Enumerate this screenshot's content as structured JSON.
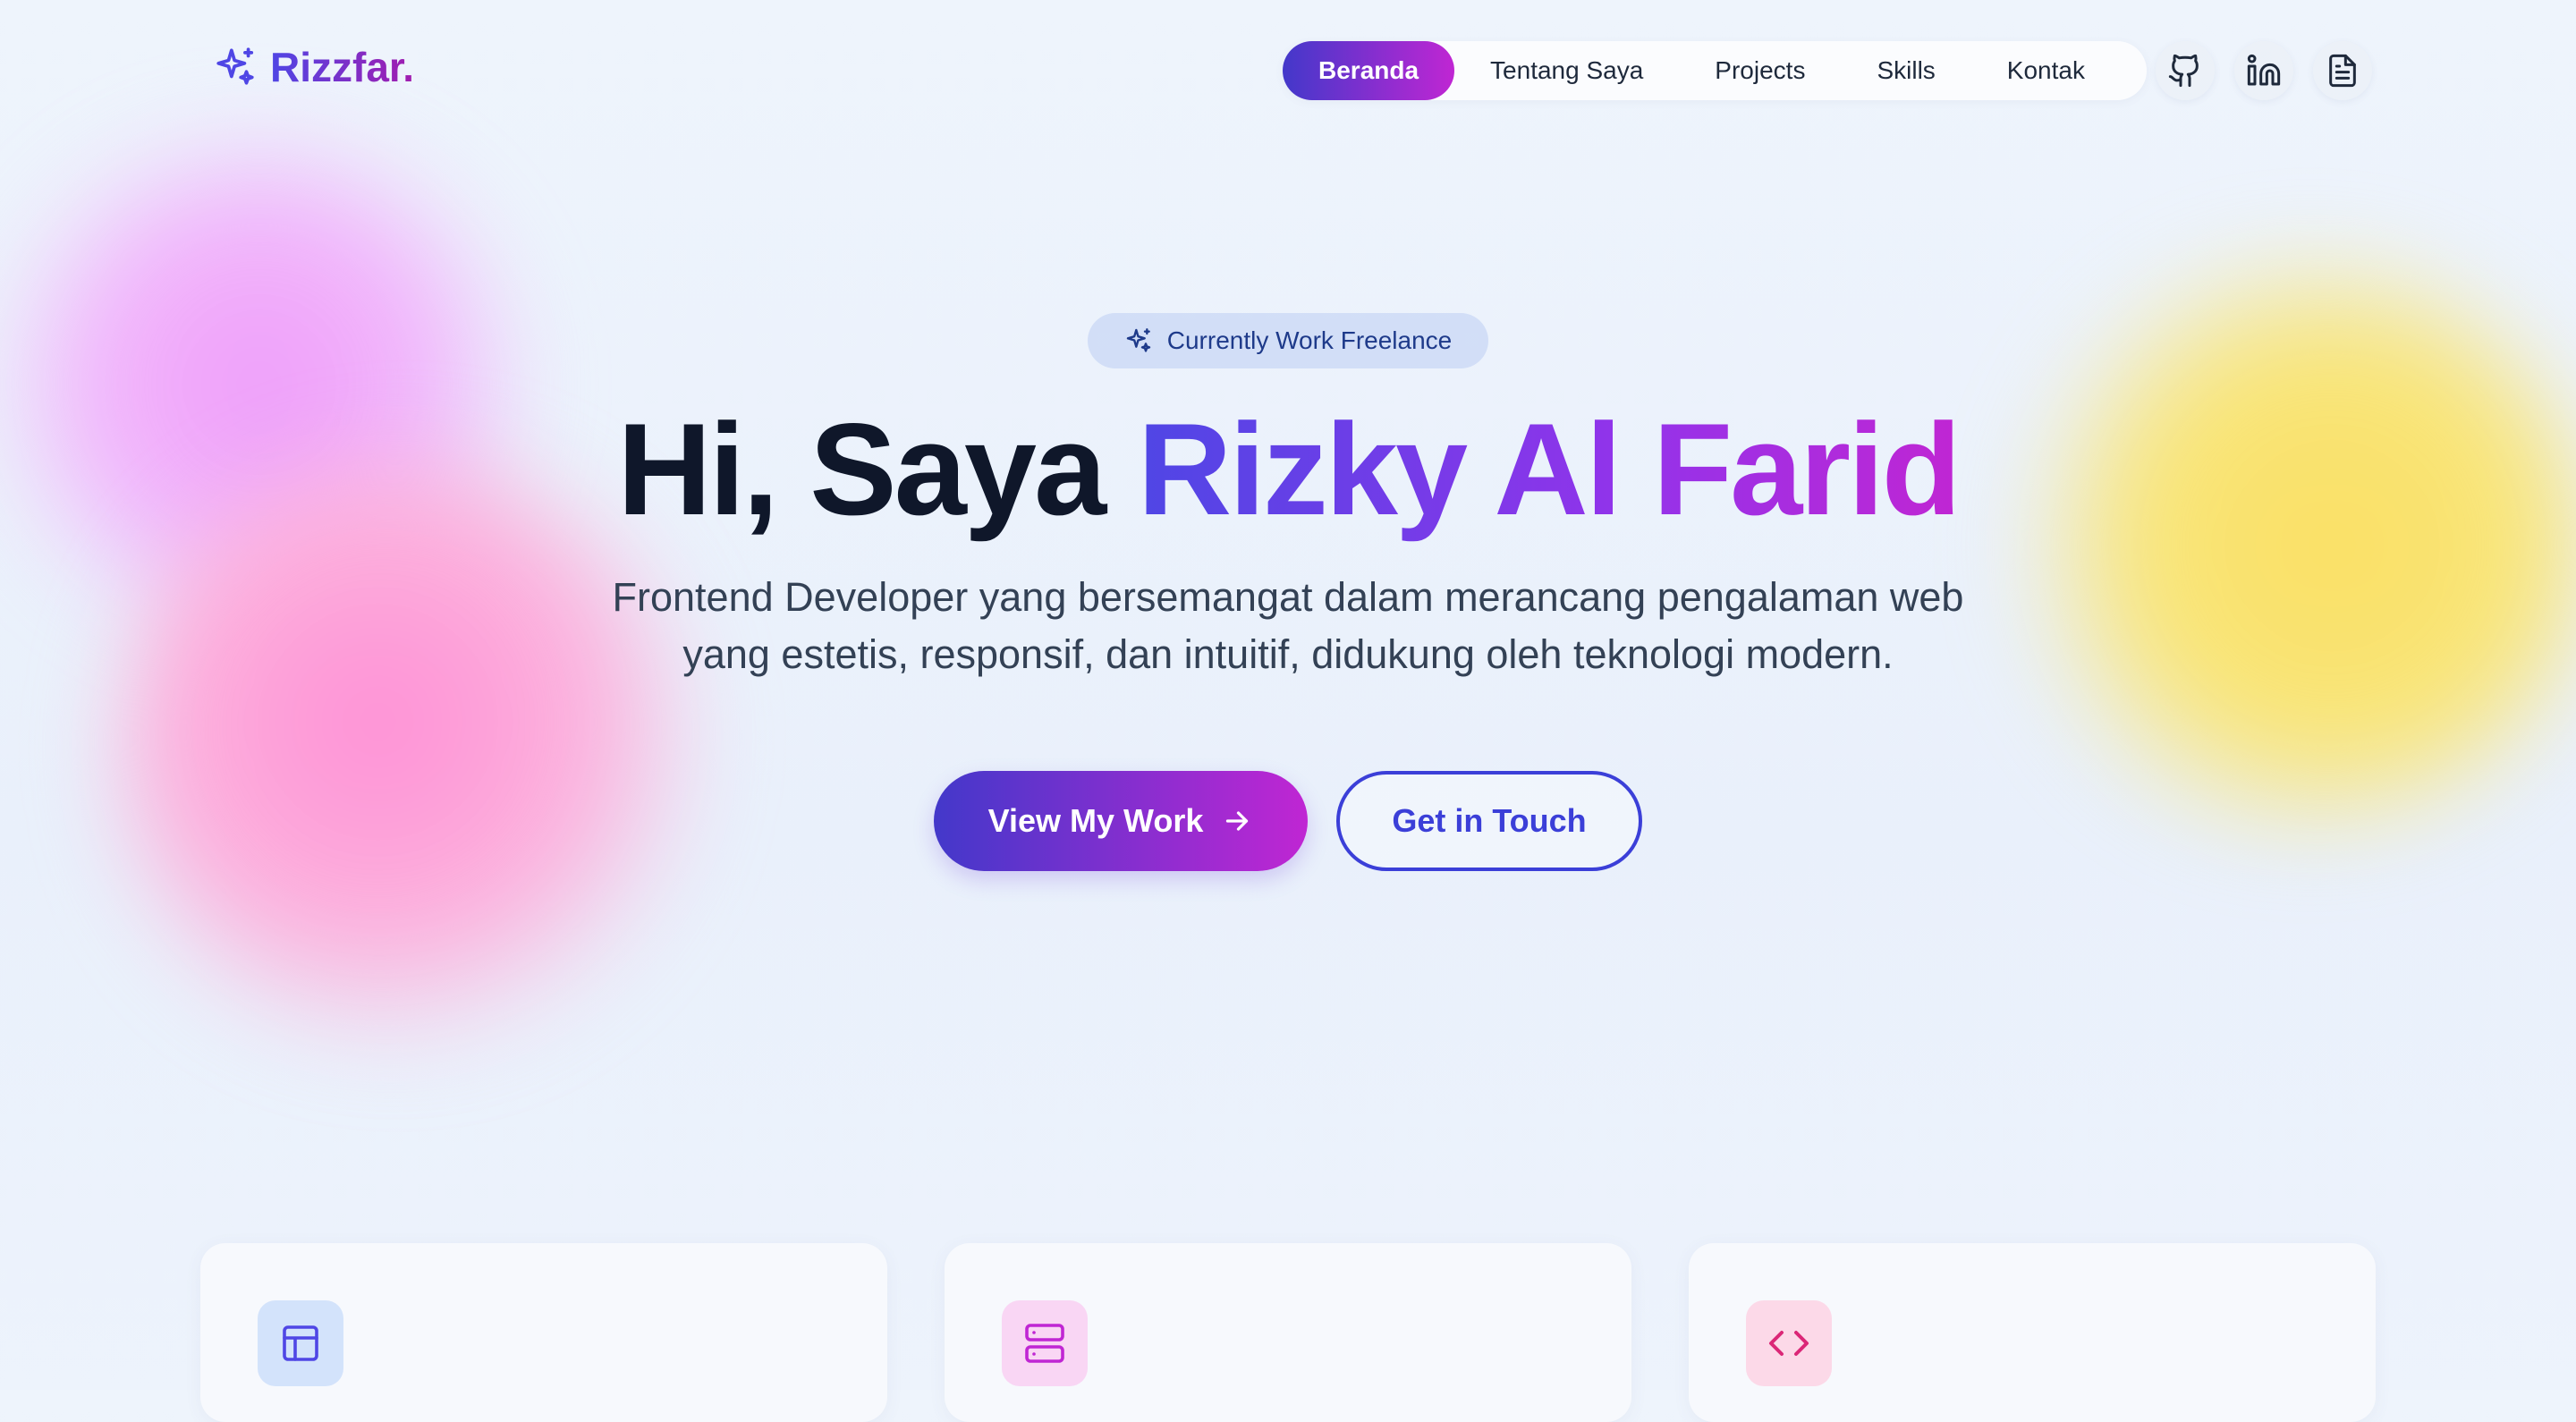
{
  "brand": {
    "name": "Rizzfar.",
    "icon": "sparkles-icon"
  },
  "nav": {
    "items": [
      {
        "label": "Beranda",
        "active": true
      },
      {
        "label": "Tentang Saya",
        "active": false
      },
      {
        "label": "Projects",
        "active": false
      },
      {
        "label": "Skills",
        "active": false
      },
      {
        "label": "Kontak",
        "active": false
      }
    ],
    "icons": [
      "github-icon",
      "linkedin-icon",
      "document-icon"
    ]
  },
  "hero": {
    "badge": "Currently Work Freelance",
    "title_plain": "Hi, Saya ",
    "title_highlight": "Rizky Al Farid",
    "subtitle": "Frontend Developer yang bersemangat dalam merancang pengalaman web yang estetis, responsif, dan intuitif, didukung oleh teknologi modern.",
    "primary_button": "View My Work",
    "secondary_button": "Get in Touch"
  },
  "cards": [
    {
      "icon": "layout-icon"
    },
    {
      "icon": "server-icon"
    },
    {
      "icon": "code-icon"
    }
  ],
  "colors": {
    "accent_start": "#4338ca",
    "accent_end": "#c026d3",
    "text_dark": "#0f172a",
    "text_body": "#334155"
  }
}
